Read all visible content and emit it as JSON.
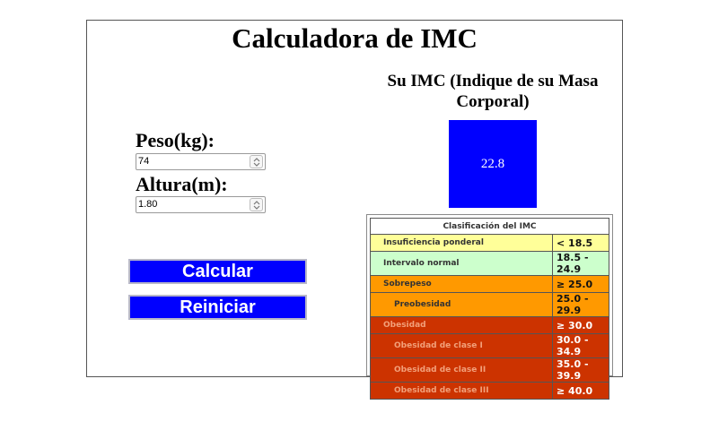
{
  "page": {
    "title": "Calculadora de IMC"
  },
  "form": {
    "weight_label": "Peso(kg):",
    "weight_value": "74",
    "height_label": "Altura(m):",
    "height_value": "1.80"
  },
  "buttons": {
    "calculate": "Calcular",
    "reset": "Reiniciar"
  },
  "result": {
    "heading": "Su IMC (Indique de su Masa Corporal)",
    "value": "22.8",
    "box_color": "#0000ff"
  },
  "classification_table": {
    "title": "Clasificación del IMC",
    "rows": [
      {
        "category": "Insuficiencia ponderal",
        "range": "< 18.5",
        "color": "#ffff99"
      },
      {
        "category": "Intervalo normal",
        "range": "18.5 - 24.9",
        "color": "#ccffcc"
      },
      {
        "category": "Sobrepeso",
        "range": "≥ 25.0",
        "color": "#ff9900"
      },
      {
        "category": "Preobesidad",
        "range": "25.0 - 29.9",
        "color": "#ff9900"
      },
      {
        "category": "Obesidad",
        "range": "≥ 30.0",
        "color": "#cc3300"
      },
      {
        "category": "Obesidad de clase I",
        "range": "30.0 - 34.9",
        "color": "#cc3300"
      },
      {
        "category": "Obesidad de clase II",
        "range": "35.0 - 39.9",
        "color": "#cc3300"
      },
      {
        "category": "Obesidad de clase III",
        "range": "≥ 40.0",
        "color": "#cc3300"
      }
    ]
  },
  "colors": {
    "button_bg": "#0000ff",
    "button_text": "#ffffff"
  }
}
